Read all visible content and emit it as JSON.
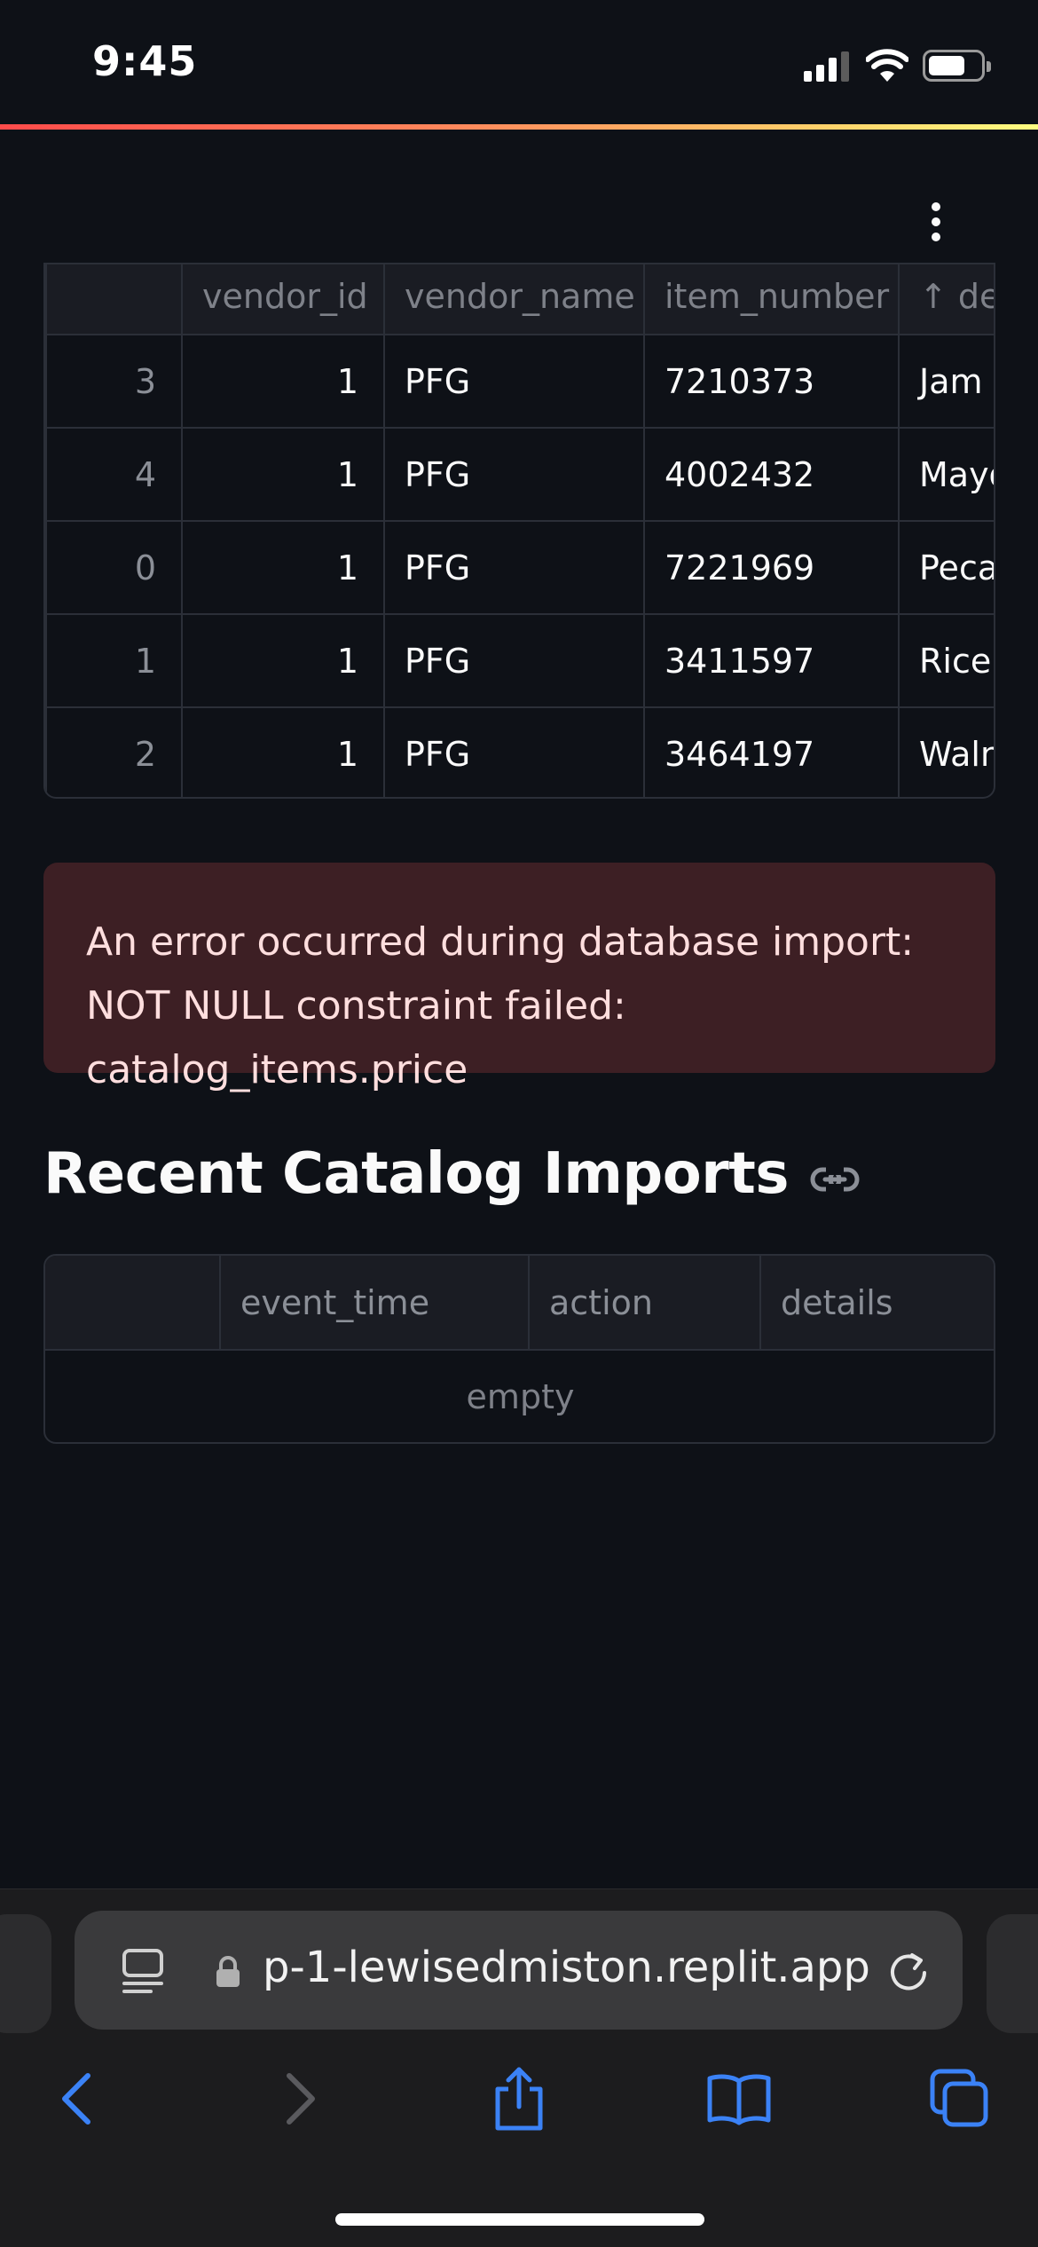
{
  "status_bar": {
    "time": "9:45"
  },
  "table1": {
    "columns": [
      "",
      "vendor_id",
      "vendor_name",
      "item_number",
      "↑ des"
    ],
    "rows": [
      {
        "index": "3",
        "vendor_id": "1",
        "vendor_name": "PFG",
        "item_number": "7210373",
        "description": "Jam"
      },
      {
        "index": "4",
        "vendor_id": "1",
        "vendor_name": "PFG",
        "item_number": "4002432",
        "description": "Mayo"
      },
      {
        "index": "0",
        "vendor_id": "1",
        "vendor_name": "PFG",
        "item_number": "7221969",
        "description": "Peca"
      },
      {
        "index": "1",
        "vendor_id": "1",
        "vendor_name": "PFG",
        "item_number": "3411597",
        "description": "Rice"
      },
      {
        "index": "2",
        "vendor_id": "1",
        "vendor_name": "PFG",
        "item_number": "3464197",
        "description": "Waln"
      }
    ]
  },
  "error": {
    "message": "An error occurred during database import: NOT NULL constraint failed: catalog_items.price"
  },
  "section": {
    "title": "Recent Catalog Imports"
  },
  "table2": {
    "columns": [
      "",
      "event_time",
      "action",
      "details"
    ],
    "empty_text": "empty"
  },
  "browser": {
    "url": "p-1-lewisedmiston.replit.app"
  },
  "icons": {
    "menu": "more-vertical-icon",
    "link": "link-icon",
    "reader": "reader-mode-icon",
    "lock": "lock-icon",
    "reload": "reload-icon",
    "back": "back-icon",
    "forward": "forward-icon",
    "share": "share-icon",
    "bookmarks": "bookmarks-icon",
    "tabs": "tabs-icon"
  }
}
